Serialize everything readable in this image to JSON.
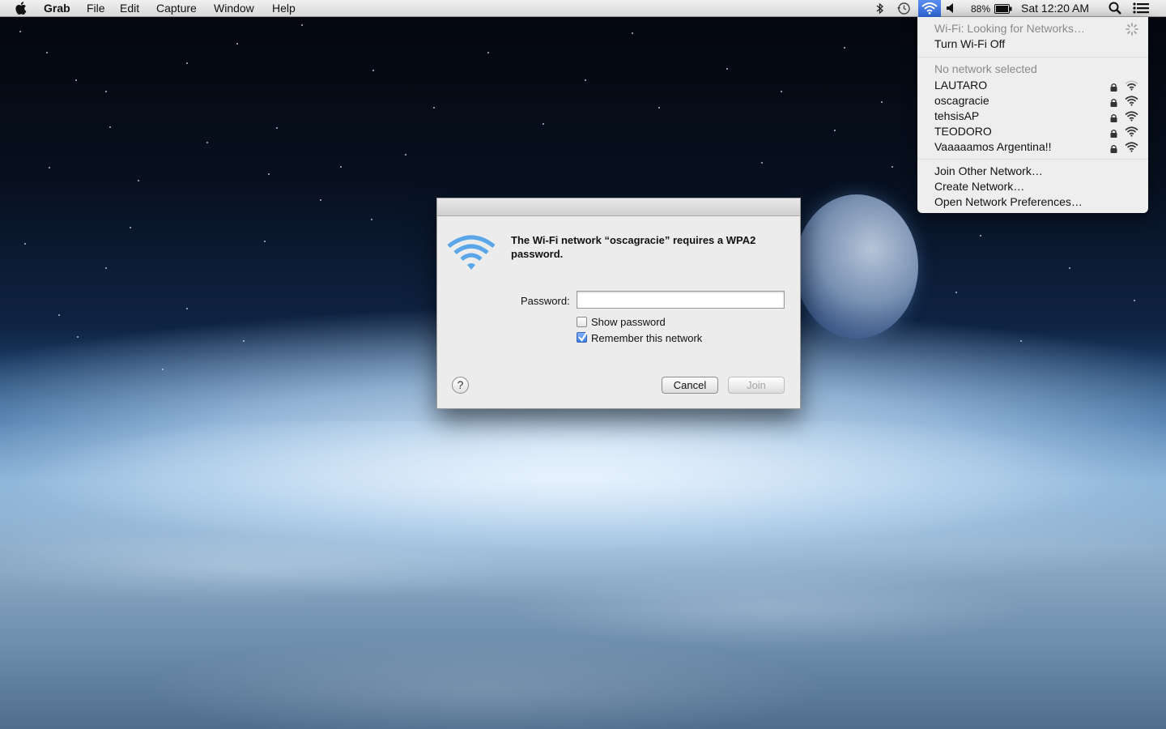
{
  "menubar": {
    "app_name": "Grab",
    "menus": [
      "File",
      "Edit",
      "Capture",
      "Window",
      "Help"
    ],
    "battery": "88%",
    "clock": "Sat 12:20 AM",
    "status_icons": [
      "bluetooth-icon",
      "time-machine-icon",
      "wifi-icon",
      "volume-icon",
      "battery-icon",
      "spotlight-icon",
      "notification-center-icon"
    ]
  },
  "wifi_menu": {
    "status": "Wi-Fi: Looking for Networks…",
    "toggle": "Turn Wi-Fi Off",
    "no_network": "No network selected",
    "networks": [
      {
        "name": "LAUTARO",
        "secured": true
      },
      {
        "name": "oscagracie",
        "secured": true
      },
      {
        "name": "tehsisAP",
        "secured": true
      },
      {
        "name": "TEODORO",
        "secured": true
      },
      {
        "name": "Vaaaaamos Argentina!!",
        "secured": true
      }
    ],
    "actions": [
      "Join Other Network…",
      "Create Network…",
      "Open Network Preferences…"
    ]
  },
  "dialog": {
    "message": "The Wi-Fi network “oscagracie” requires a WPA2 password.",
    "password_label": "Password:",
    "password_value": "",
    "show_password_label": "Show password",
    "show_password_checked": false,
    "remember_label": "Remember this network",
    "remember_checked": true,
    "help_label": "?",
    "cancel_label": "Cancel",
    "join_label": "Join",
    "join_enabled": false
  },
  "colors": {
    "accent": "#3b7be8",
    "wifi_icon": "#5aa6e8"
  }
}
